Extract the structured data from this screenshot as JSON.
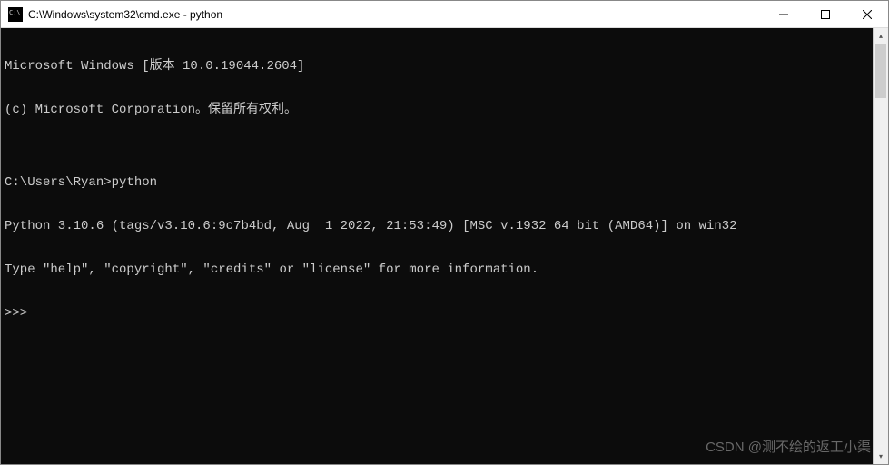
{
  "window": {
    "title": "C:\\Windows\\system32\\cmd.exe - python"
  },
  "terminal": {
    "lines": [
      "Microsoft Windows [版本 10.0.19044.2604]",
      "(c) Microsoft Corporation。保留所有权利。",
      "",
      "C:\\Users\\Ryan>python",
      "Python 3.10.6 (tags/v3.10.6:9c7b4bd, Aug  1 2022, 21:53:49) [MSC v.1932 64 bit (AMD64)] on win32",
      "Type \"help\", \"copyright\", \"credits\" or \"license\" for more information.",
      ">>>"
    ]
  },
  "watermark": {
    "text": "CSDN @测不绘的返工小渠"
  }
}
